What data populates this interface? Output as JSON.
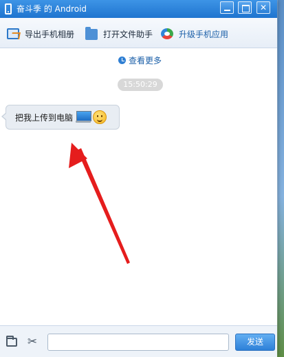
{
  "window": {
    "title": "奋斗季 的 Android"
  },
  "toolbar": {
    "export_album": "导出手机相册",
    "open_file_helper": "打开文件助手",
    "upgrade_app": "升级手机应用"
  },
  "chat": {
    "view_more": "查看更多",
    "timestamp": "15:50:29",
    "message_text": "把我上传到电脑"
  },
  "input": {
    "value": "",
    "send_label": "发送"
  },
  "colors": {
    "titlebar": "#1f74cf",
    "accent": "#2d80d8",
    "arrow": "#e51d1d"
  },
  "icons": [
    "phone-icon",
    "export-album-icon",
    "folder-icon",
    "upgrade-app-icon",
    "clock-icon",
    "computer-icon",
    "smiley-icon",
    "folder-tool-icon",
    "scissors-icon"
  ]
}
